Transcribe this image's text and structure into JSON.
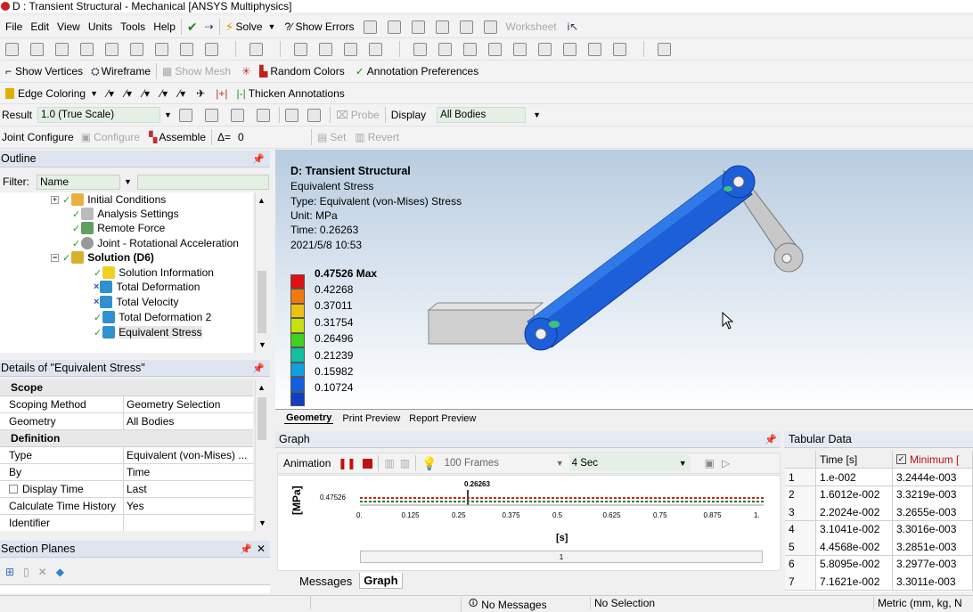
{
  "window": {
    "title": "D : Transient Structural - Mechanical [ANSYS Multiphysics]"
  },
  "menu": [
    "File",
    "Edit",
    "View",
    "Units",
    "Tools",
    "Help"
  ],
  "menu_actions": {
    "solve": "Solve",
    "show_errors": "?⁄ Show Errors",
    "worksheet": "Worksheet"
  },
  "toolbar3": {
    "show_vertices": "Show Vertices",
    "wireframe": "Wireframe",
    "show_mesh": "Show Mesh",
    "random_colors": "Random Colors",
    "annotation_prefs": "Annotation Preferences"
  },
  "toolbar4": {
    "edge_coloring": "Edge Coloring",
    "thicken": "Thicken Annotations"
  },
  "toolbar5": {
    "result_label": "Result",
    "result_value": "1.0 (True Scale)",
    "probe": "Probe",
    "display_label": "Display",
    "display_value": "All Bodies"
  },
  "toolbar6": {
    "joint_configure": "Joint Configure",
    "configure": "Configure",
    "assemble": "Assemble",
    "delta_label": "Δ=",
    "delta_value": "0",
    "set": "Set",
    "revert": "Revert"
  },
  "outline": {
    "title": "Outline",
    "filter_label": "Filter:",
    "filter_value": "Name",
    "items": [
      "Initial Conditions",
      "Analysis Settings",
      "Remote Force",
      "Joint - Rotational Acceleration",
      "Solution (D6)",
      "Solution Information",
      "Total Deformation",
      "Total Velocity",
      "Total Deformation 2",
      "Equivalent Stress"
    ]
  },
  "details": {
    "title": "Details of \"Equivalent Stress\"",
    "scope": "Scope",
    "scoping_method_k": "Scoping Method",
    "scoping_method_v": "Geometry Selection",
    "geometry_k": "Geometry",
    "geometry_v": "All Bodies",
    "definition": "Definition",
    "type_k": "Type",
    "type_v": "Equivalent (von-Mises) ...",
    "by_k": "By",
    "by_v": "Time",
    "display_time_k": "Display Time",
    "display_time_v": "Last",
    "calc_k": "Calculate Time History",
    "calc_v": "Yes",
    "identifier_k": "Identifier",
    "identifier_v": ""
  },
  "section_planes": {
    "title": "Section Planes"
  },
  "viewport": {
    "title": "D: Transient Structural",
    "line1": "Equivalent Stress",
    "line2": "Type: Equivalent (von-Mises) Stress",
    "line3": "Unit: MPa",
    "line4": "Time: 0.26263",
    "line5": "2021/5/8 10:53",
    "legend": [
      "0.47526 Max",
      "0.42268",
      "0.37011",
      "0.31754",
      "0.26496",
      "0.21239",
      "0.15982",
      "0.10724"
    ],
    "legend_colors": [
      "#e01010",
      "#f07a10",
      "#f0c010",
      "#c8e010",
      "#40d020",
      "#10c0a0",
      "#10a0e0",
      "#1060e0",
      "#1040c0"
    ],
    "tabs": [
      "Geometry",
      "Print Preview",
      "Report Preview"
    ]
  },
  "graph": {
    "title": "Graph",
    "animation": "Animation",
    "frames": "100 Frames",
    "seconds": "4 Sec",
    "ylabel": "[MPa]",
    "xlabel": "[s]",
    "ymark": "0.47526",
    "current": "0.26263",
    "xticks": [
      "0.",
      "0.125",
      "0.25",
      "0.375",
      "0.5",
      "0.625",
      "0.75",
      "0.875",
      "1."
    ],
    "slider_value": "1"
  },
  "bottom_tabs": [
    "Messages",
    "Graph"
  ],
  "tabular": {
    "title": "Tabular Data",
    "col_time": "Time [s]",
    "col_min": "Minimum [",
    "rows": [
      [
        "1",
        "1.e-002",
        "3.2444e-003"
      ],
      [
        "2",
        "1.6012e-002",
        "3.3219e-003"
      ],
      [
        "3",
        "2.2024e-002",
        "3.2655e-003"
      ],
      [
        "4",
        "3.1041e-002",
        "3.3016e-003"
      ],
      [
        "5",
        "4.4568e-002",
        "3.2851e-003"
      ],
      [
        "6",
        "5.8095e-002",
        "3.2977e-003"
      ],
      [
        "7",
        "7.1621e-002",
        "3.3011e-003"
      ]
    ]
  },
  "status": {
    "messages": "No Messages",
    "selection": "No Selection",
    "units": "Metric (mm, kg, N"
  }
}
